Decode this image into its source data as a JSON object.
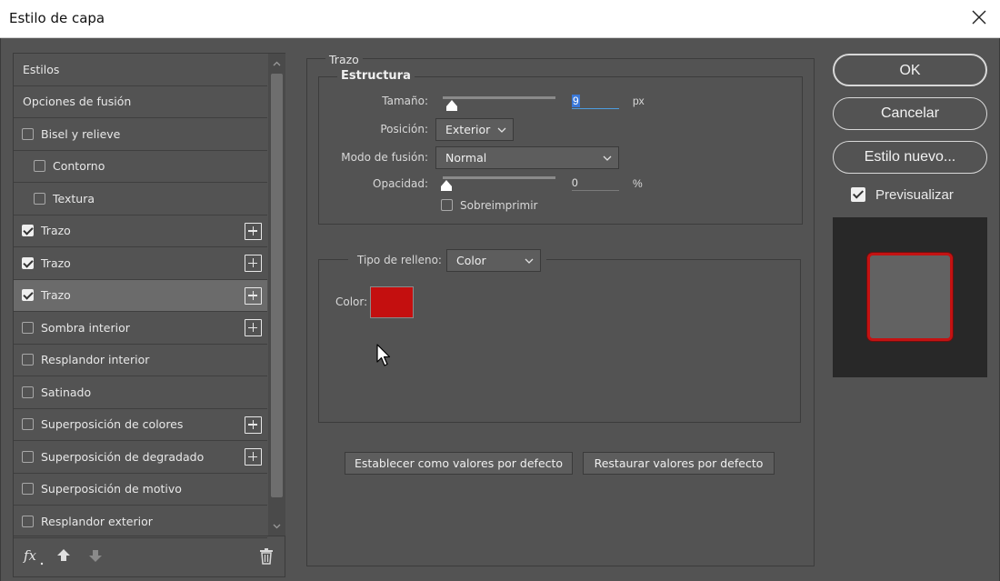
{
  "window": {
    "title": "Estilo de capa"
  },
  "style_list": {
    "items": [
      {
        "label": "Estilos",
        "checkbox": false,
        "checked": false,
        "indent": false,
        "plus": false,
        "selected": false
      },
      {
        "label": "Opciones de fusión",
        "checkbox": false,
        "checked": false,
        "indent": false,
        "plus": false,
        "selected": false
      },
      {
        "label": "Bisel y relieve",
        "checkbox": true,
        "checked": false,
        "indent": false,
        "plus": false,
        "selected": false
      },
      {
        "label": "Contorno",
        "checkbox": true,
        "checked": false,
        "indent": true,
        "plus": false,
        "selected": false
      },
      {
        "label": "Textura",
        "checkbox": true,
        "checked": false,
        "indent": true,
        "plus": false,
        "selected": false
      },
      {
        "label": "Trazo",
        "checkbox": true,
        "checked": true,
        "indent": false,
        "plus": true,
        "selected": false
      },
      {
        "label": "Trazo",
        "checkbox": true,
        "checked": true,
        "indent": false,
        "plus": true,
        "selected": false
      },
      {
        "label": "Trazo",
        "checkbox": true,
        "checked": true,
        "indent": false,
        "plus": true,
        "selected": true
      },
      {
        "label": "Sombra interior",
        "checkbox": true,
        "checked": false,
        "indent": false,
        "plus": true,
        "selected": false
      },
      {
        "label": "Resplandor interior",
        "checkbox": true,
        "checked": false,
        "indent": false,
        "plus": false,
        "selected": false
      },
      {
        "label": "Satinado",
        "checkbox": true,
        "checked": false,
        "indent": false,
        "plus": false,
        "selected": false
      },
      {
        "label": "Superposición de colores",
        "checkbox": true,
        "checked": false,
        "indent": false,
        "plus": true,
        "selected": false
      },
      {
        "label": "Superposición de degradado",
        "checkbox": true,
        "checked": false,
        "indent": false,
        "plus": true,
        "selected": false
      },
      {
        "label": "Superposición de motivo",
        "checkbox": true,
        "checked": false,
        "indent": false,
        "plus": false,
        "selected": false
      },
      {
        "label": "Resplandor exterior",
        "checkbox": true,
        "checked": false,
        "indent": false,
        "plus": false,
        "selected": false
      }
    ],
    "footer_icons": [
      "fx-icon",
      "arrow-up-icon",
      "arrow-down-icon",
      "trash-icon"
    ]
  },
  "stroke": {
    "section_title": "Trazo",
    "structure_title": "Estructura",
    "size_label": "Tamaño:",
    "size_value": "9",
    "size_unit": "px",
    "size_fraction": 0.03,
    "position_label": "Posición:",
    "position_value": "Exterior",
    "blend_label": "Modo de fusión:",
    "blend_value": "Normal",
    "opacity_label": "Opacidad:",
    "opacity_value": "0",
    "opacity_unit": "%",
    "overprint_label": "Sobreimprimir",
    "overprint_checked": false,
    "fill_type_label": "Tipo de relleno:",
    "fill_type_value": "Color",
    "color_label": "Color:",
    "color_value": "#c40f0f"
  },
  "buttons": {
    "set_default": "Establecer como valores por defecto",
    "reset_default": "Restaurar valores por defecto",
    "ok": "OK",
    "cancel": "Cancelar",
    "new_style": "Estilo nuevo...",
    "preview_label": "Previsualizar",
    "preview_checked": true
  },
  "colors": {
    "background": "#535353",
    "selected_row": "#6b6b6b",
    "stroke_color": "#c40f0f",
    "preview_bg": "#282828"
  }
}
